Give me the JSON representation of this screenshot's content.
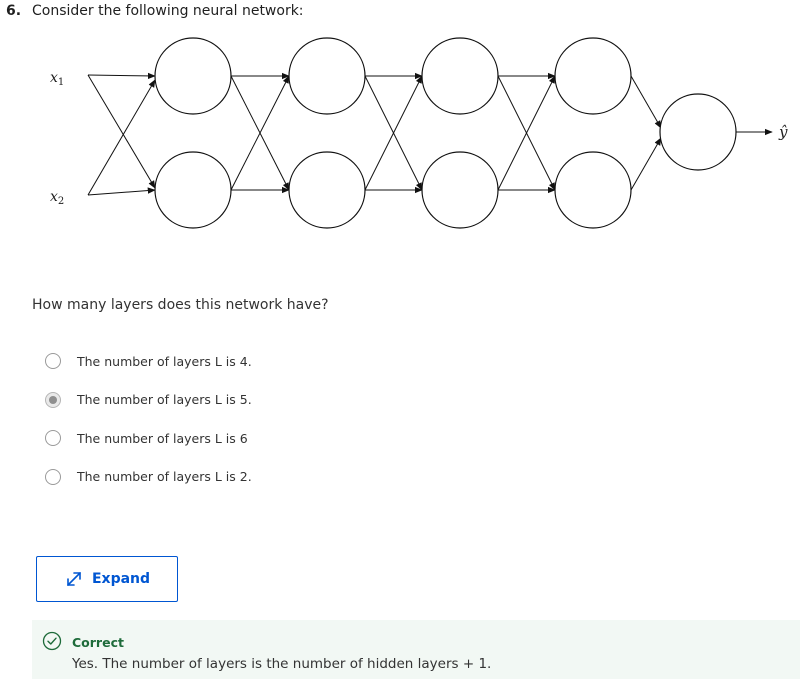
{
  "question": {
    "number": "6.",
    "prompt": "Consider the following neural network:",
    "sub_question": "How many layers does this network have?"
  },
  "diagram": {
    "input_labels": [
      "x1",
      "x2"
    ],
    "output_label": "ŷ",
    "layers": [
      2,
      2,
      2,
      2,
      1
    ]
  },
  "options": [
    {
      "label": "The number of layers L is 4.",
      "selected": false
    },
    {
      "label": "The number of layers L is 5.",
      "selected": true
    },
    {
      "label": "The number of layers L is 6",
      "selected": false
    },
    {
      "label": "The number of layers L is 2.",
      "selected": false
    }
  ],
  "expand_button": {
    "label": "Expand"
  },
  "feedback": {
    "status": "Correct",
    "message": "Yes. The number of layers is the number of hidden layers + 1."
  },
  "colors": {
    "accent": "#0056d2",
    "success": "#1e6b3a",
    "feedback_bg": "#f2f8f4"
  }
}
